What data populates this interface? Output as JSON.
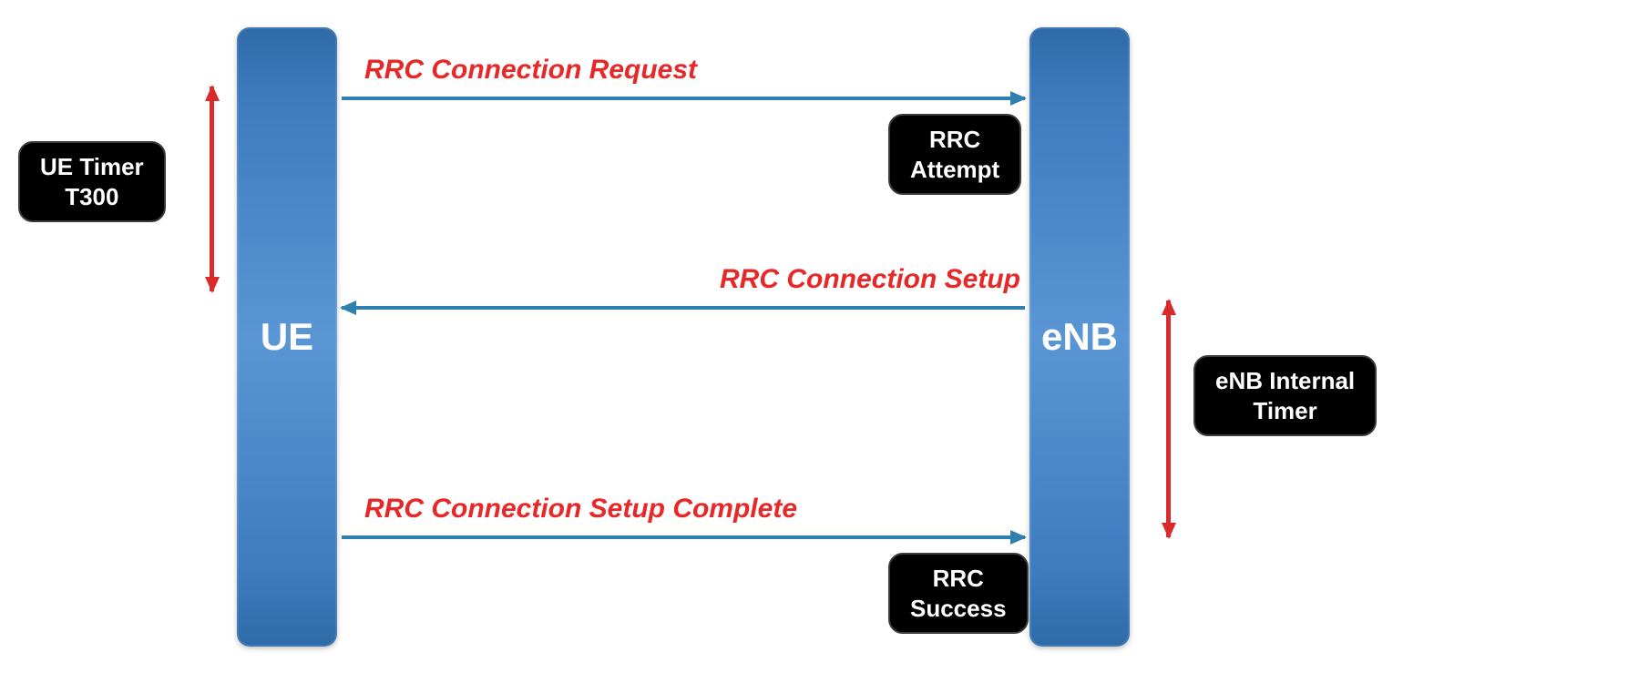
{
  "nodes": {
    "ue": "UE",
    "enb": "eNB"
  },
  "messages": {
    "request": "RRC Connection Request",
    "setup": "RRC Connection Setup",
    "complete": "RRC Connection Setup Complete"
  },
  "annotations": {
    "rrc_attempt": "RRC\nAttempt",
    "rrc_success": "RRC\nSuccess"
  },
  "timers": {
    "ue": "UE Timer\nT300",
    "enb": "eNB Internal\nTimer"
  }
}
